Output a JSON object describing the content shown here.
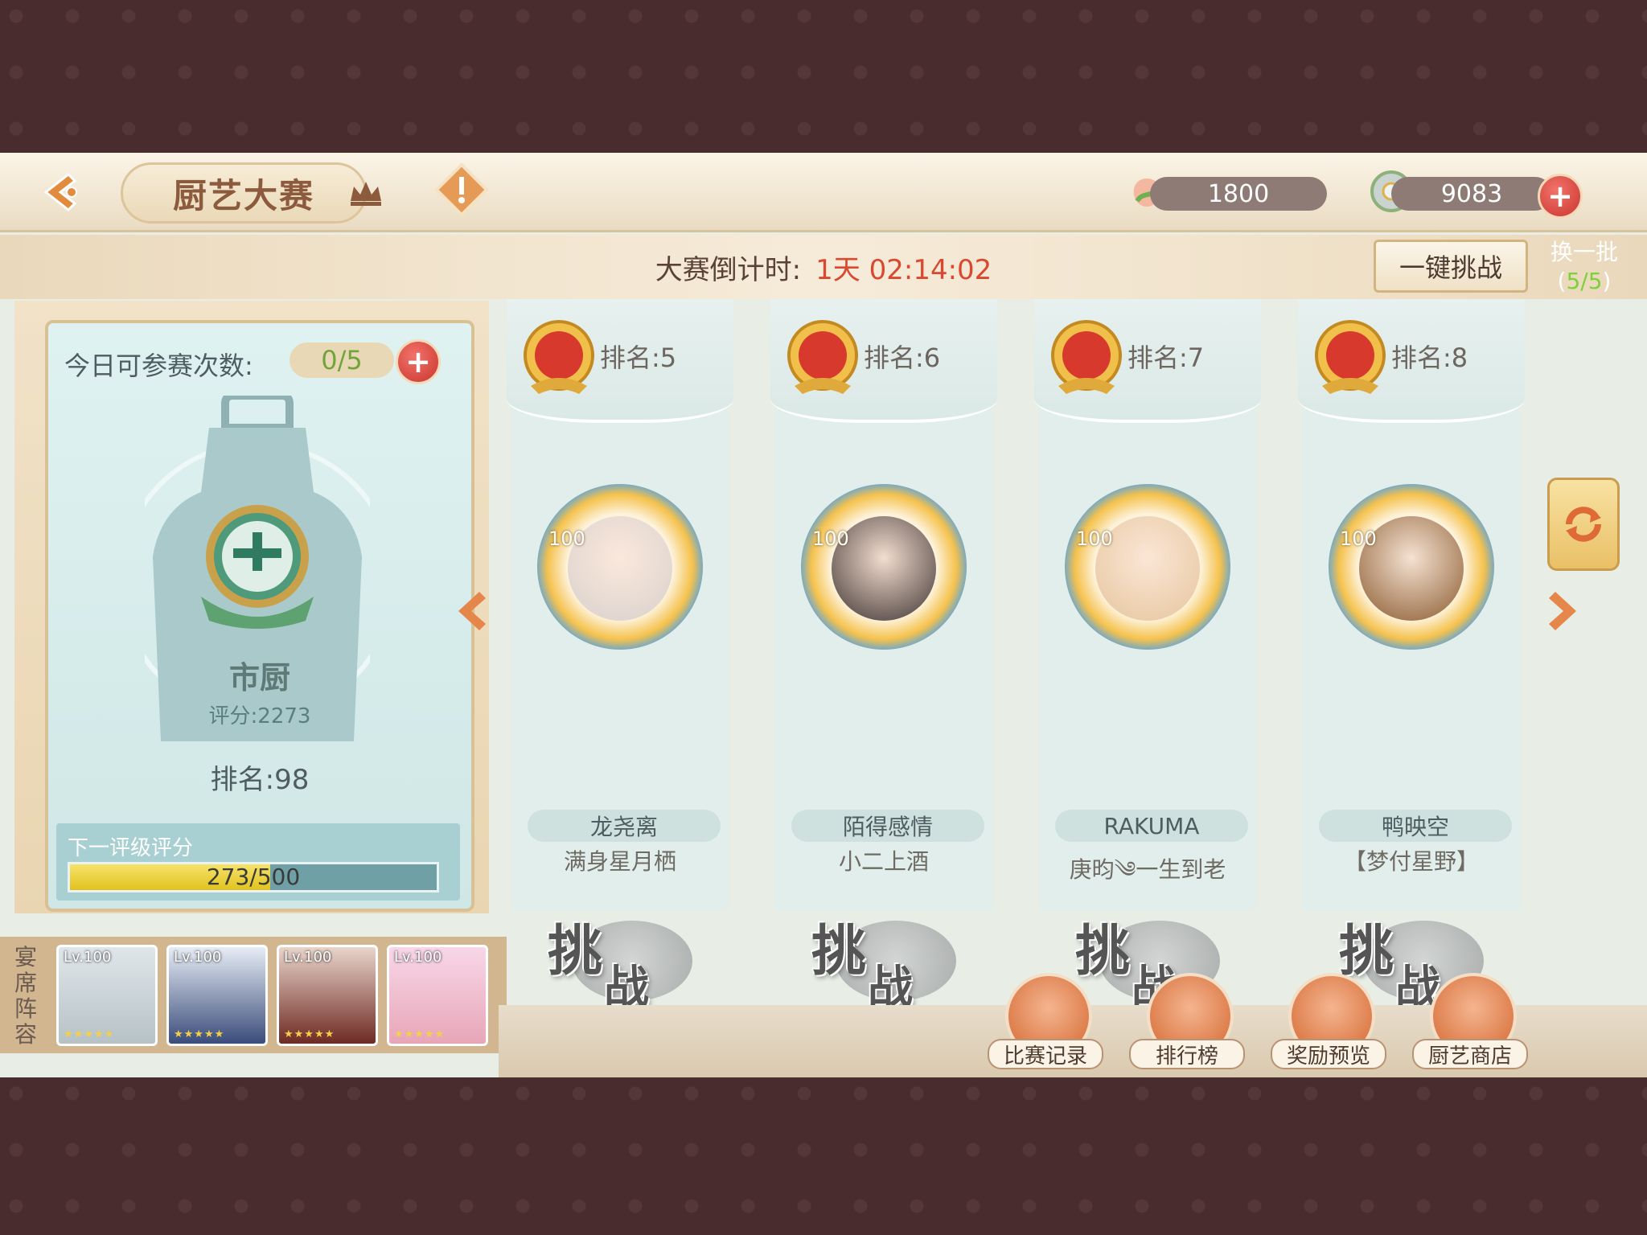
{
  "header": {
    "title": "厨艺大赛",
    "currency1": "1800",
    "currency2": "9083"
  },
  "banner": {
    "countdown_label": "大赛倒计时:",
    "countdown_value": "1天 02:14:02",
    "quick_challenge": "一键挑战",
    "swap_label": "换一批",
    "swap_count": "5/5"
  },
  "player": {
    "tries_label": "今日可参赛次数:",
    "tries_value": "0/5",
    "rank_title": "市厨",
    "score": "评分:2273",
    "rank": "排名:98",
    "next_label": "下一评级评分",
    "progress_text": "273/500",
    "progress_fraction": 0.546
  },
  "lineup": {
    "label": "宴席阵容",
    "cards": [
      {
        "lv": "Lv.100"
      },
      {
        "lv": "Lv.100"
      },
      {
        "lv": "Lv.100"
      },
      {
        "lv": "Lv.100"
      }
    ]
  },
  "opponents": [
    {
      "rank": "排名:5",
      "level": "100",
      "name": "龙尧离",
      "guild": "满身星月栖",
      "challenge_a": "挑",
      "challenge_b": "战"
    },
    {
      "rank": "排名:6",
      "level": "100",
      "name": "陌得感情",
      "guild": "小二上酒",
      "challenge_a": "挑",
      "challenge_b": "战"
    },
    {
      "rank": "排名:7",
      "level": "100",
      "name": "RAKUMA",
      "guild": "庚昀༄一生到老",
      "challenge_a": "挑",
      "challenge_b": "战"
    },
    {
      "rank": "排名:8",
      "level": "100",
      "name": "鸭映空",
      "guild": "【梦付星野】",
      "challenge_a": "挑",
      "challenge_b": "战"
    }
  ],
  "footer": {
    "record": "比赛记录",
    "ranking": "排行榜",
    "rewards": "奖励预览",
    "shop": "厨艺商店"
  },
  "colors": {
    "accent": "#d9482f",
    "panel": "#dff2f1",
    "progress": "#e2c21e"
  }
}
